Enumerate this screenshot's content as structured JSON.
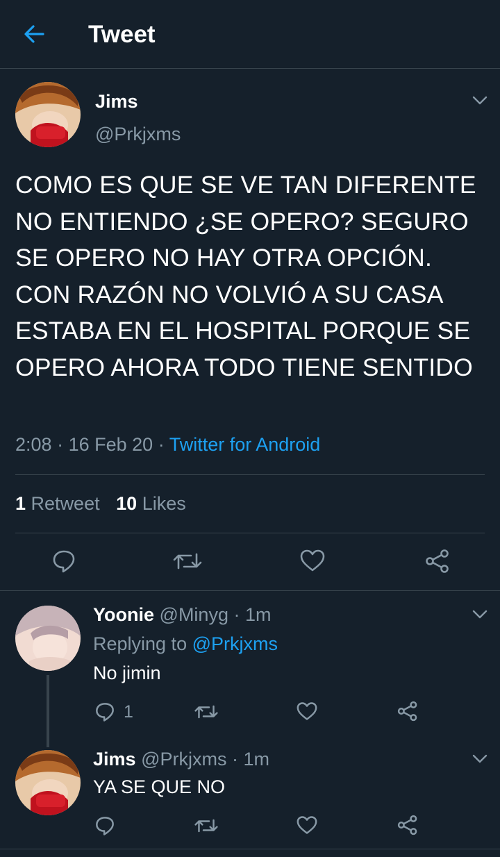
{
  "header": {
    "title": "Tweet"
  },
  "main_tweet": {
    "name": "Jims",
    "handle": "@Prkjxms",
    "text": "COMO ES QUE SE VE TAN DIFERENTE NO ENTIENDO ¿SE OPERO? SEGURO SE OPERO NO HAY OTRA OPCIÓN. CON RAZÓN NO VOLVIÓ A SU CASA ESTABA EN EL HOSPITAL PORQUE SE OPERO AHORA TODO TIENE SENTIDO",
    "time": "2:08",
    "date": "16 Feb 20",
    "source": "Twitter for Android",
    "retweets_count": "1",
    "retweets_label": "Retweet",
    "likes_count": "10",
    "likes_label": "Likes"
  },
  "replies": [
    {
      "name": "Yoonie",
      "handle": "@Minyg",
      "time": "1m",
      "replying_prefix": "Replying to",
      "replying_to": "@Prkjxms",
      "text": "No jimin",
      "reply_count": "1"
    },
    {
      "name": "Jims",
      "handle": "@Prkjxms",
      "time": "1m",
      "text": "YA SE QUE NO"
    }
  ],
  "separator": "·",
  "colors": {
    "background": "#15202b",
    "accent": "#1da1f2",
    "muted": "#8899a6",
    "divider": "#38444d"
  },
  "icons": [
    "back-arrow-icon",
    "chevron-down-icon",
    "reply-icon",
    "retweet-icon",
    "like-icon",
    "share-icon"
  ]
}
